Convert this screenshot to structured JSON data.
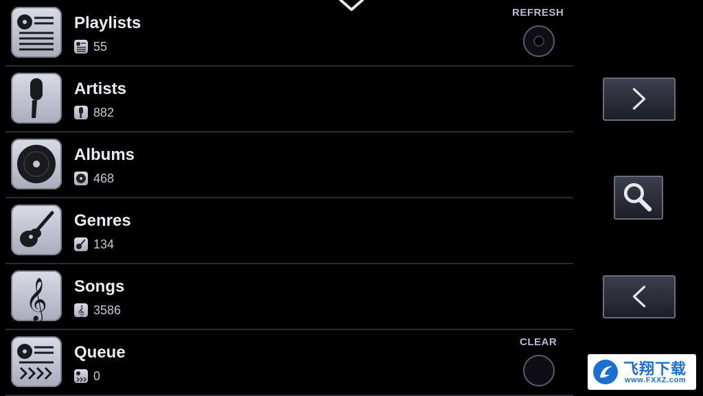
{
  "list": {
    "items": [
      {
        "title": "Playlists",
        "count": "55",
        "icon": "playlist-icon"
      },
      {
        "title": "Artists",
        "count": "882",
        "icon": "microphone-icon"
      },
      {
        "title": "Albums",
        "count": "468",
        "icon": "disc-icon"
      },
      {
        "title": "Genres",
        "count": "134",
        "icon": "guitar-icon"
      },
      {
        "title": "Songs",
        "count": "3586",
        "icon": "treble-clef-icon"
      },
      {
        "title": "Queue",
        "count": "0",
        "icon": "queue-icon"
      }
    ]
  },
  "actions": {
    "refresh_label": "REFRESH",
    "clear_label": "CLEAR"
  },
  "side": {
    "next_icon": "chevron-right-icon",
    "search_icon": "search-icon",
    "back_icon": "chevron-left-icon"
  },
  "watermark": {
    "name": "飞翔下载",
    "url": "www.FXXZ.com"
  },
  "colors": {
    "background": "#000000",
    "tile": "#c4c6d3",
    "label_accent": "#b8bcd8"
  }
}
